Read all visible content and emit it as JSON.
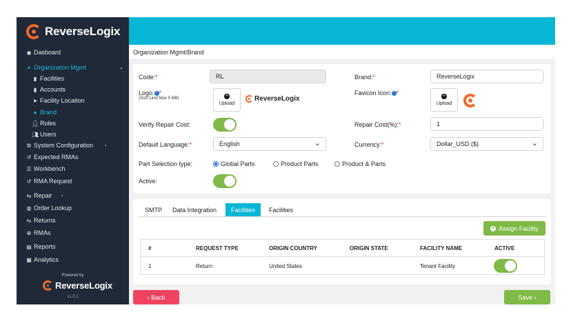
{
  "sidebar": {
    "brand": "ReverseLogix",
    "items": [
      {
        "label": "Dasboard",
        "icon": "dashboard-icon"
      },
      {
        "label": "Organization Mgmt",
        "icon": "org-icon"
      },
      {
        "label": "Facilities",
        "icon": "building-icon"
      },
      {
        "label": "Accounts",
        "icon": "building-icon"
      },
      {
        "label": "Facility Location",
        "icon": "location-icon"
      },
      {
        "label": "Brand",
        "icon": "dot-icon"
      },
      {
        "label": "Roles",
        "icon": "user-icon"
      },
      {
        "label": "Users",
        "icon": "users-icon"
      },
      {
        "label": "System Configuration",
        "icon": "gear-icon"
      },
      {
        "label": "Expected RMAs",
        "icon": "undo-icon"
      },
      {
        "label": "Workbench",
        "icon": "list-icon"
      },
      {
        "label": "RMA Request",
        "icon": "undo-icon"
      },
      {
        "label": "Repair",
        "icon": "swap-icon"
      },
      {
        "label": "Order Lookup",
        "icon": "globe-icon"
      },
      {
        "label": "Returns",
        "icon": "swap-icon"
      },
      {
        "label": "RMAs",
        "icon": "plus-circle-icon"
      },
      {
        "label": "Reports",
        "icon": "file-icon"
      },
      {
        "label": "Analytics",
        "icon": "table-icon"
      }
    ],
    "powered_by": "Powered by",
    "footer_brand": "ReverseLogix",
    "version": "v1.0.1"
  },
  "breadcrumb": "Organization Mgmt/Brand",
  "form": {
    "code_label": "Code:",
    "code_value": "RL",
    "brand_label": "Brand:",
    "brand_value": "ReverseLogix",
    "logo_label": "Logo:",
    "logo_hint": "(Size Limit Max 5 MB)",
    "upload_label": "Upload",
    "logo_preview_text": "ReverseLogix",
    "favicon_label": "Favicon Icon:",
    "verify_label": "Verify Repair Cost:",
    "repair_cost_label": "Repair Cost(%):",
    "repair_cost_value": "1",
    "language_label": "Default Language:",
    "language_value": "English",
    "currency_label": "Currency:",
    "currency_value": "Dollar_USD ($)",
    "part_selection_label": "Part Selection type:",
    "part_options": [
      "Global Parts",
      "Product Parts",
      "Product & Parts"
    ],
    "part_selected": "Global Parts",
    "active_label": "Active:",
    "verify_on": true,
    "active_on": true
  },
  "tabs": [
    "SMTP",
    "Data Integration",
    "Facilities",
    "Facilities"
  ],
  "active_tab": 2,
  "assign_button": "Assign Facility",
  "table": {
    "headers": [
      "#",
      "REQUEST TYPE",
      "ORIGIN COUNTRY",
      "ORIGIN STATE",
      "FACILITY NAME",
      "ACTIVE"
    ],
    "rows": [
      {
        "num": "1",
        "request_type": "Return",
        "origin_country": "United States",
        "origin_state": "",
        "facility_name": "Tenant Facility",
        "active": true
      }
    ]
  },
  "back_button": "‹ Back",
  "save_button": "Save ›",
  "colors": {
    "accent": "#06b6d4",
    "green": "#7fba46",
    "red": "#ef4461",
    "brand_orange": "#f06a2a",
    "sidebar": "#1f2937"
  }
}
